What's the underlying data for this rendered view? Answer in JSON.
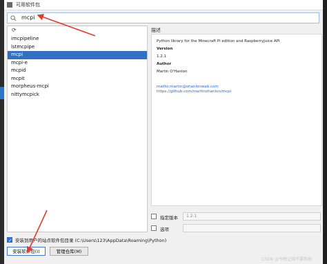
{
  "window": {
    "title": "可用软件包"
  },
  "search": {
    "value": "mcpi"
  },
  "packages": [
    "imcpipeline",
    "lstmcpipe",
    "mcpi",
    "mcpi-e",
    "mcpid",
    "mcpit",
    "morpheus-mcpi",
    "nittymcpick"
  ],
  "selected_index": 2,
  "description": {
    "label": "描述",
    "summary": "Python library for the Minecraft Pi edition and RaspberryJuice API",
    "version_heading": "Version",
    "version": "1.2.1",
    "author_heading": "Author",
    "author": "Martin O'Hanlon",
    "email_link": "mailto:martin@ohanlonweb.com",
    "repo_link": "https://github.com/martinohanlon/mcpi"
  },
  "options": {
    "specify_version_label": "指定版本",
    "specify_version_value": "1.2.1",
    "options_label": "选项",
    "options_value": ""
  },
  "install_to_user": {
    "checked": true,
    "label": "安装到用户的站点软件包目录 (C:\\Users\\123\\AppData\\Roaming\\Python)"
  },
  "buttons": {
    "install": "安装软件包(I)",
    "manage": "管理仓库(M)"
  },
  "watermark": "CSDN @今晚记得不要熬夜",
  "colors": {
    "selection": "#3270c3",
    "link": "#2f65c8",
    "arrow": "#e53b2c"
  }
}
